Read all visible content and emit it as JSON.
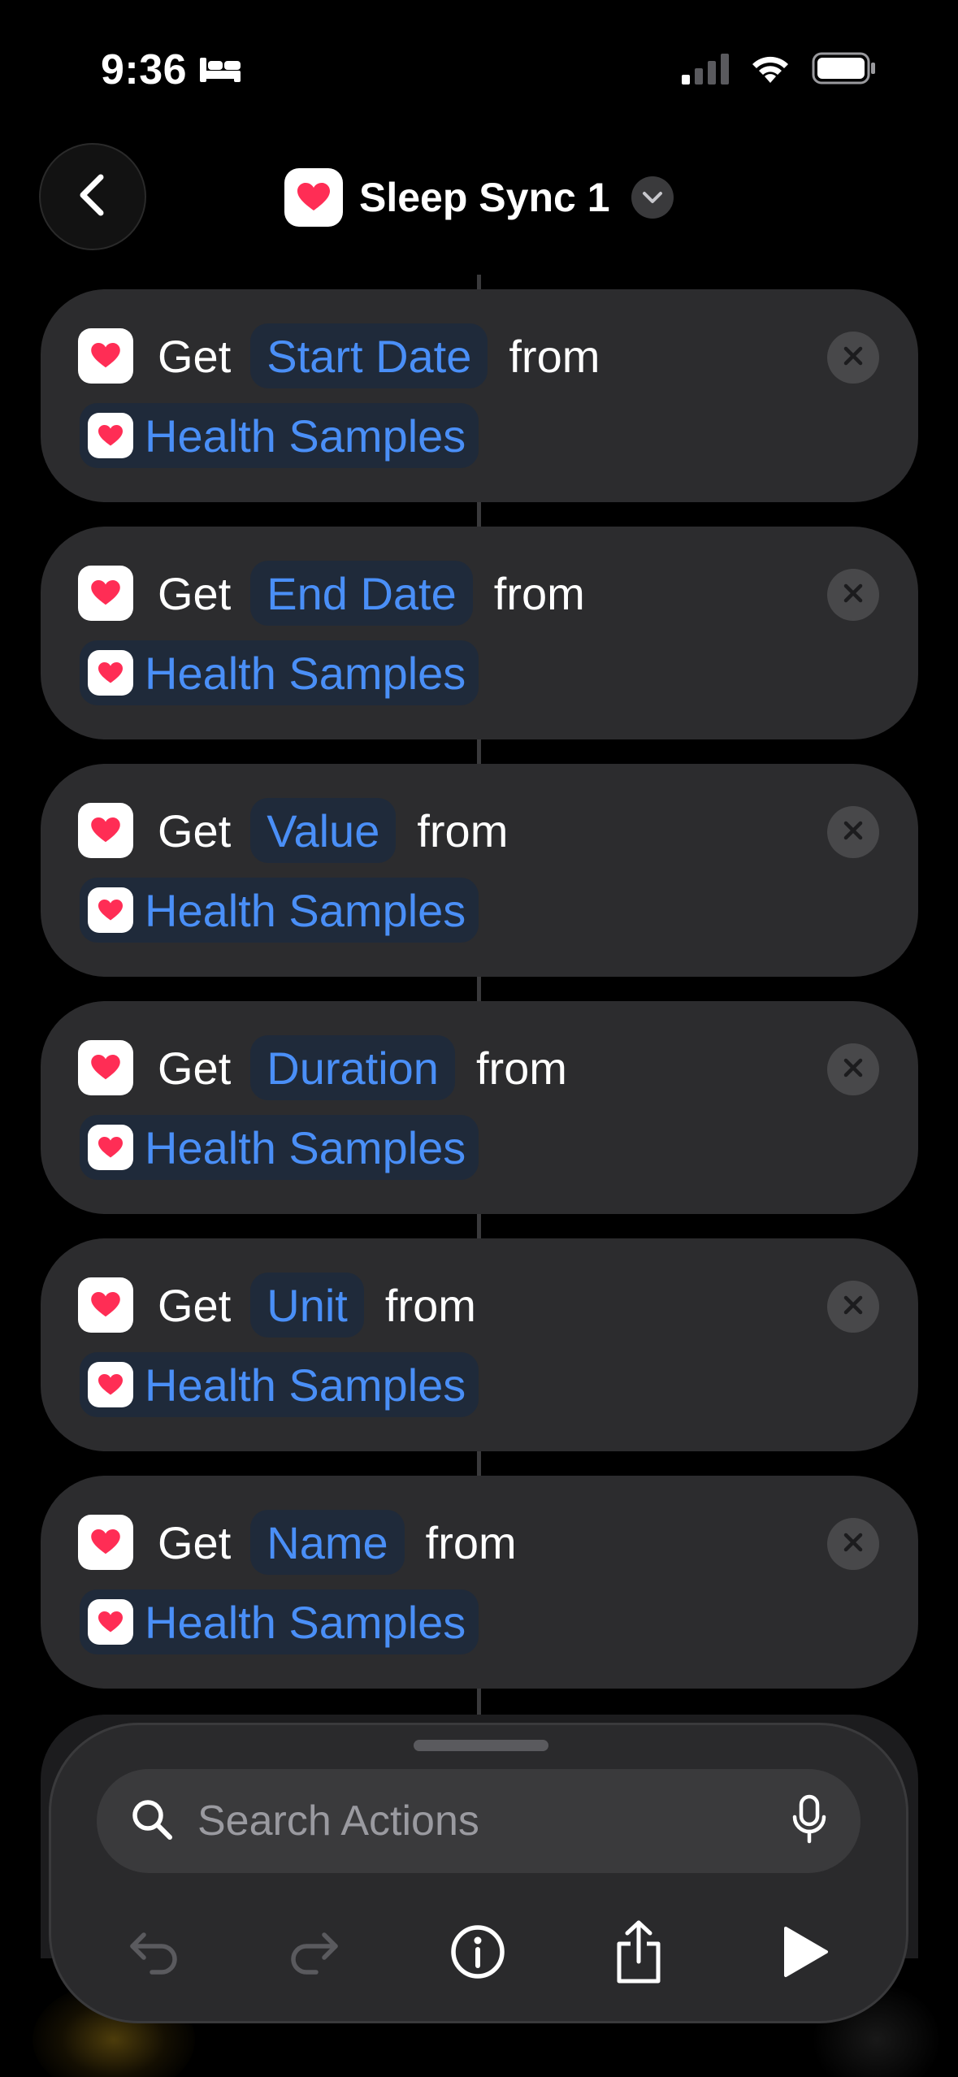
{
  "status_bar": {
    "time": "9:36",
    "sleep_icon": "bed-icon",
    "signal_icon": "cellular-signal-icon",
    "wifi_icon": "wifi-icon",
    "battery_icon": "battery-icon"
  },
  "nav": {
    "back_icon": "chevron-left-icon",
    "title": "Sleep Sync 1",
    "app_icon": "health-heart-icon",
    "menu_icon": "chevron-down-icon"
  },
  "actions": [
    {
      "verb": "Get",
      "property": "Start Date",
      "from": "from",
      "variable": "Health Samples"
    },
    {
      "verb": "Get",
      "property": "End Date",
      "from": "from",
      "variable": "Health Samples"
    },
    {
      "verb": "Get",
      "property": "Value",
      "from": "from",
      "variable": "Health Samples"
    },
    {
      "verb": "Get",
      "property": "Duration",
      "from": "from",
      "variable": "Health Samples"
    },
    {
      "verb": "Get",
      "property": "Unit",
      "from": "from",
      "variable": "Health Samples"
    },
    {
      "verb": "Get",
      "property": "Name",
      "from": "from",
      "variable": "Health Samples"
    }
  ],
  "search": {
    "placeholder": "Search Actions",
    "icon": "search-icon",
    "mic_icon": "microphone-icon"
  },
  "toolbar": {
    "undo_icon": "undo-icon",
    "redo_icon": "redo-icon",
    "info_icon": "info-icon",
    "share_icon": "share-icon",
    "run_icon": "play-icon"
  },
  "colors": {
    "background": "#000000",
    "card": "#2c2c2e",
    "token_text": "#4a8ff7",
    "token_bg": "#1f2a3a",
    "heart": "#ff2d55"
  }
}
